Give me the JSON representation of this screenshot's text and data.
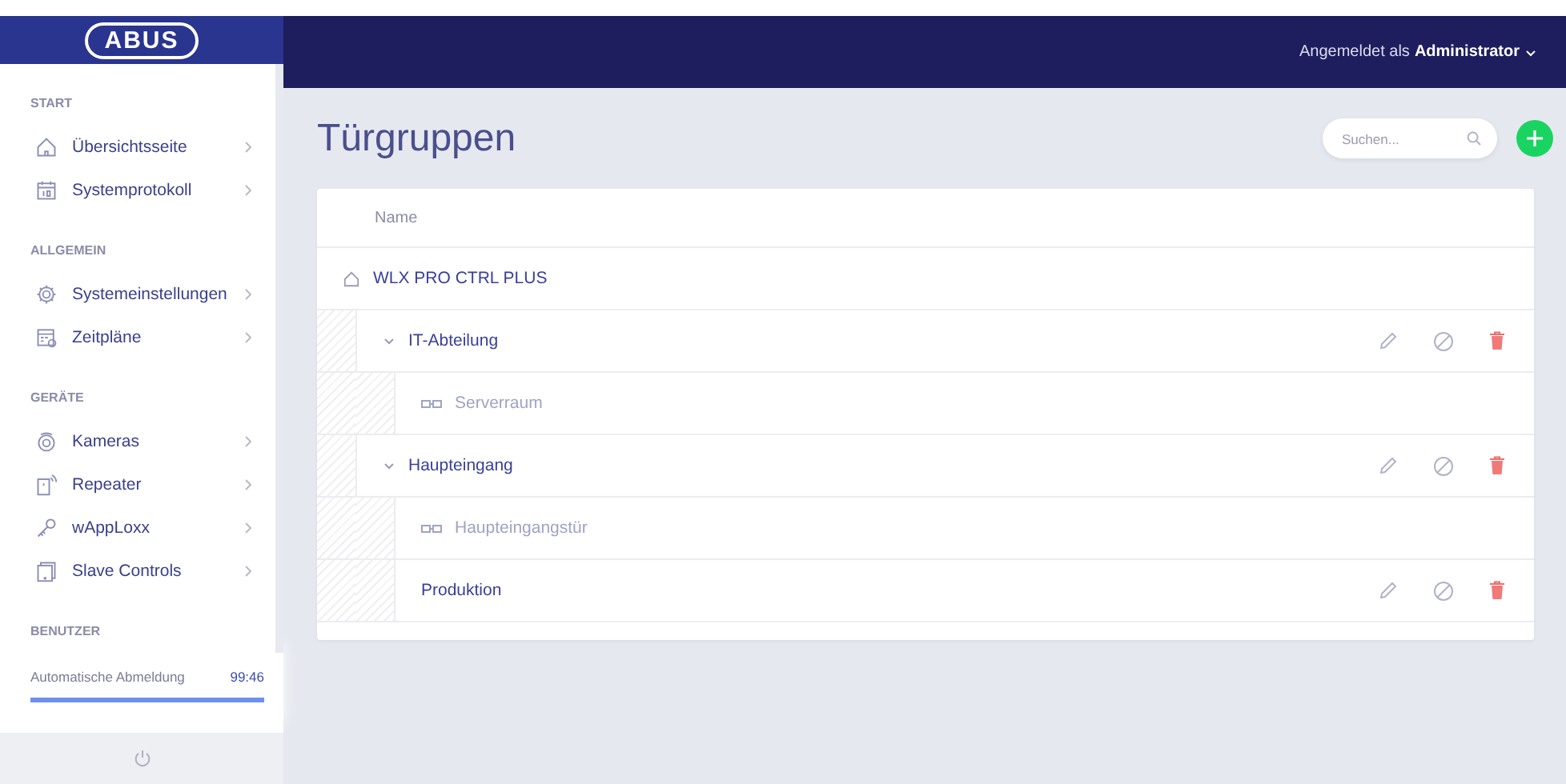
{
  "header": {
    "logo": "ABUS",
    "user_prefix": "Angemeldet als",
    "user_name": "Administrator"
  },
  "sidebar": {
    "sections": [
      {
        "title": "START",
        "items": [
          {
            "label": "Übersichtsseite"
          },
          {
            "label": "Systemprotokoll"
          }
        ]
      },
      {
        "title": "ALLGEMEIN",
        "items": [
          {
            "label": "Systemeinstellungen"
          },
          {
            "label": "Zeitpläne"
          }
        ]
      },
      {
        "title": "GERÄTE",
        "items": [
          {
            "label": "Kameras"
          },
          {
            "label": "Repeater"
          },
          {
            "label": "wAppLoxx"
          },
          {
            "label": "Slave Controls"
          }
        ]
      },
      {
        "title": "BENUTZER"
      }
    ],
    "logout": {
      "label": "Automatische Abmeldung",
      "time": "99:46",
      "level": 1
    }
  },
  "page": {
    "title": "Türgruppen",
    "search": {
      "placeholder": "Suchen..."
    }
  },
  "table": {
    "column": "Name",
    "root": {
      "label": "WLX PRO CTRL PLUS",
      "children": [
        {
          "label": "IT-Abteilung",
          "kind": "group",
          "expanded": true,
          "children": [
            {
              "label": "Serverraum",
              "kind": "door"
            }
          ]
        },
        {
          "label": "Haupteingang",
          "kind": "group",
          "expanded": true,
          "children": [
            {
              "label": "Haupteingangstür",
              "kind": "door"
            },
            {
              "label": "Produktion",
              "kind": "group"
            }
          ]
        }
      ]
    }
  }
}
